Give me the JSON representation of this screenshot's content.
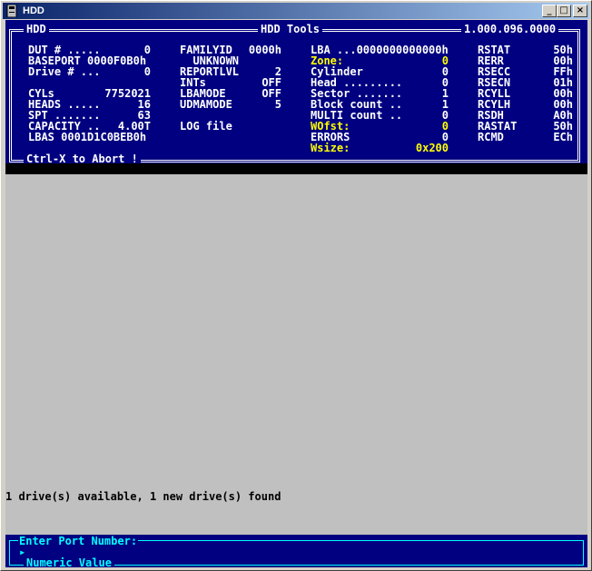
{
  "window": {
    "title": "HDD",
    "buttons": [
      "_",
      "□",
      "×"
    ]
  },
  "header": {
    "left": "HDD",
    "center": "HDD Tools",
    "right": "1.000.096.0000",
    "footer": "Ctrl-X to Abort !"
  },
  "col1": [
    [
      "DUT # .....",
      "0"
    ],
    [
      "BASEPORT 0000F0B0h",
      ""
    ],
    [
      "Drive # ...",
      "0"
    ],
    [
      "",
      ""
    ],
    [
      "CYLs",
      "7752021"
    ],
    [
      "HEADS .....",
      "16"
    ],
    [
      "SPT .......",
      "63"
    ],
    [
      "CAPACITY ..",
      "4.00T"
    ],
    [
      "LBAS 0001D1C0BEB0h",
      ""
    ]
  ],
  "col2": [
    [
      "FAMILYID",
      "0000h"
    ],
    [
      "  UNKNOWN",
      ""
    ],
    [
      "REPORTLVL",
      "2"
    ],
    [
      "INTs",
      "OFF"
    ],
    [
      "LBAMODE",
      "OFF"
    ],
    [
      "UDMAMODE",
      "5"
    ],
    [
      "",
      ""
    ],
    [
      "LOG file",
      ""
    ]
  ],
  "col3": [
    [
      "LBA ...0000000000000h",
      "",
      false
    ],
    [
      "Zone:",
      "0",
      true
    ],
    [
      "Cylinder",
      "0",
      false
    ],
    [
      "Head .........",
      "0",
      false
    ],
    [
      "Sector .......",
      "1",
      false
    ],
    [
      "Block count ..",
      "1",
      false
    ],
    [
      "MULTI count ..",
      "0",
      false
    ],
    [
      "WOfst:",
      "0",
      true
    ],
    [
      "ERRORS",
      "0",
      false
    ],
    [
      "Wsize:",
      "0x200",
      true
    ]
  ],
  "col4": [
    [
      "RSTAT",
      "50h"
    ],
    [
      "RERR",
      "00h"
    ],
    [
      "RSECC",
      "FFh"
    ],
    [
      "RSECN",
      "01h"
    ],
    [
      "RCYLL",
      "00h"
    ],
    [
      "RCYLH",
      "00h"
    ],
    [
      "RSDH",
      "A0h"
    ],
    [
      "RASTAT",
      "50h"
    ],
    [
      "RCMD",
      "ECh"
    ]
  ],
  "message": "1 drive(s) available, 1 new drive(s) found",
  "prompt": {
    "label": "Enter Port Number:",
    "cursor": "▸",
    "hint": "Numeric Value"
  }
}
